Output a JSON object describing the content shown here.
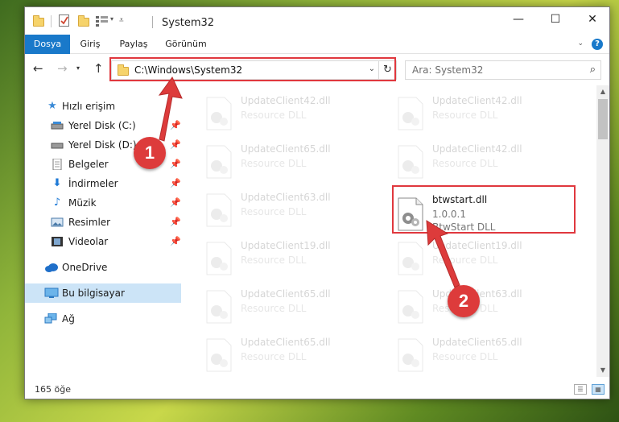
{
  "window": {
    "title": "System32",
    "controls": {
      "minimize": "—",
      "maximize": "☐",
      "close": "✕"
    }
  },
  "ribbon": {
    "tabs": [
      "Dosya",
      "Giriş",
      "Paylaş",
      "Görünüm"
    ],
    "help": "?"
  },
  "address": {
    "path": "C:\\Windows\\System32",
    "search_placeholder": "Ara: System32"
  },
  "nav": {
    "items": [
      {
        "label": "Hızlı erişim",
        "icon": "star-icon",
        "color": "#3a8ad6",
        "pinned": false,
        "selected": false
      },
      {
        "label": "Yerel Disk (C:)",
        "icon": "drive-icon",
        "color": "#555555",
        "pinned": true,
        "selected": false
      },
      {
        "label": "Yerel Disk (D:)",
        "icon": "drive-icon",
        "color": "#555555",
        "pinned": true,
        "selected": false
      },
      {
        "label": "Belgeler",
        "icon": "document-icon",
        "color": "#6a6a6a",
        "pinned": true,
        "selected": false
      },
      {
        "label": "İndirmeler",
        "icon": "download-icon",
        "color": "#1f7ad6",
        "pinned": true,
        "selected": false
      },
      {
        "label": "Müzik",
        "icon": "music-icon",
        "color": "#1f7ad6",
        "pinned": true,
        "selected": false
      },
      {
        "label": "Resimler",
        "icon": "pictures-icon",
        "color": "#4a7aa8",
        "pinned": true,
        "selected": false
      },
      {
        "label": "Videolar",
        "icon": "videos-icon",
        "color": "#333333",
        "pinned": true,
        "selected": false
      },
      {
        "label": "OneDrive",
        "icon": "cloud-icon",
        "color": "#1f6fc9",
        "pinned": false,
        "selected": false
      },
      {
        "label": "Bu bilgisayar",
        "icon": "computer-icon",
        "color": "#2b79c2",
        "pinned": false,
        "selected": true
      },
      {
        "label": "Ağ",
        "icon": "network-icon",
        "color": "#2b79c2",
        "pinned": false,
        "selected": false
      }
    ]
  },
  "files": {
    "left": [
      {
        "name": "UpdateClient42.dll",
        "type": "Resource DLL"
      },
      {
        "name": "UpdateClient65.dll",
        "type": "Resource DLL"
      },
      {
        "name": "UpdateClient63.dll",
        "type": "Resource DLL"
      },
      {
        "name": "UpdateClient19.dll",
        "type": "Resource DLL"
      },
      {
        "name": "UpdateClient65.dll",
        "type": "Resource DLL"
      },
      {
        "name": "UpdateClient65.dll",
        "type": "Resource DLL"
      }
    ],
    "right": [
      {
        "name": "UpdateClient42.dll",
        "type": "Resource DLL"
      },
      {
        "name": "UpdateClient42.dll",
        "type": "Resource DLL"
      },
      {
        "name": "btwstart.dll",
        "version": "1.0.0.1",
        "type": "BtwStart DLL",
        "highlighted": true
      },
      {
        "name": "UpdateClient19.dll",
        "type": "Resource DLL"
      },
      {
        "name": "UpdateClient63.dll",
        "type": "Resource DLL"
      },
      {
        "name": "UpdateClient65.dll",
        "type": "Resource DLL"
      }
    ]
  },
  "status": {
    "count": "165 öğe"
  },
  "annotations": {
    "step1": "1",
    "step2": "2",
    "color": "#dd3b3b"
  }
}
